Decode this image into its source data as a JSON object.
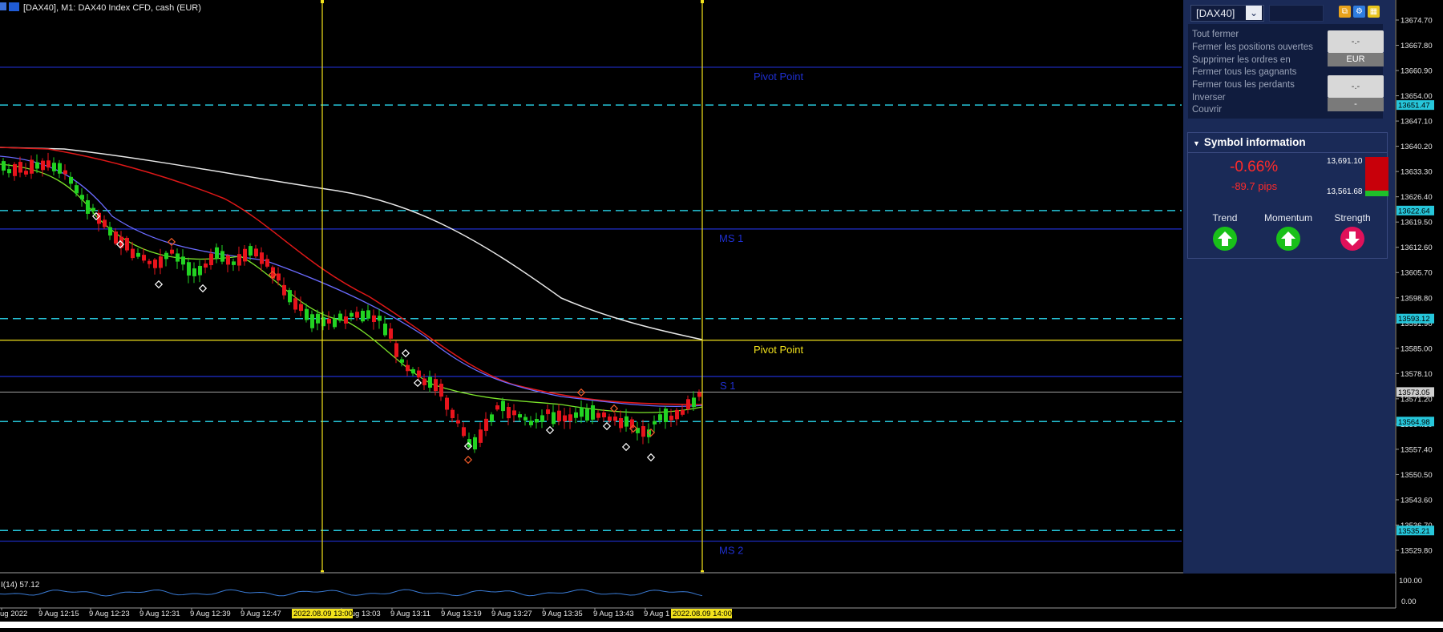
{
  "chart": {
    "title": "[DAX40], M1:  DAX40 Index CFD, cash (EUR)",
    "levels": [
      {
        "label": "Pivot Point",
        "kind": "pivot-blue",
        "price": 13661.8
      },
      {
        "label": "MS 1",
        "kind": "blue-line",
        "price": 13617.6
      },
      {
        "label": "Pivot Point",
        "kind": "pivot-yellow",
        "price": 13587.2
      },
      {
        "label": "S 1",
        "kind": "blue-line",
        "price": 13577.3
      },
      {
        "label": "MS 2",
        "kind": "blue-line",
        "price": 13532.3
      }
    ],
    "cyan_levels": [
      13651.47,
      13622.64,
      13593.12,
      13564.98,
      13535.21
    ],
    "current_price": "13573.05",
    "current_price_value": 13573.05,
    "cyan_level_labels": [
      "13651.47",
      "13622.64",
      "13593.12",
      "13564.98",
      "13535.21"
    ],
    "price_axis": {
      "min": 13529.8,
      "max": 13674.7,
      "ticks": [
        13674.7,
        13667.8,
        13660.9,
        13654.0,
        13647.1,
        13640.2,
        13633.3,
        13626.4,
        13619.5,
        13612.6,
        13605.7,
        13598.8,
        13591.9,
        13585.0,
        13578.1,
        13571.2,
        13564.3,
        13557.4,
        13550.5,
        13543.6,
        13536.7,
        13529.8
      ],
      "tick_labels": [
        "13674.70",
        "13667.80",
        "13660.90",
        "13654.00",
        "13647.10",
        "13640.20",
        "13633.30",
        "13626.40",
        "13619.50",
        "13612.60",
        "13605.70",
        "13598.80",
        "13591.90",
        "13585.00",
        "13578.10",
        "13571.20",
        "13564.30",
        "13557.40",
        "13550.50",
        "13543.60",
        "13536.70",
        "13529.80"
      ]
    },
    "time_labels": [
      "ug 2022",
      "9 Aug 12:15",
      "9 Aug 12:23",
      "9 Aug 12:31",
      "9 Aug 12:39",
      "9 Aug 12:47",
      "9 Aug 13:03",
      "9 Aug 13:11",
      "9 Aug 13:19",
      "9 Aug 13:27",
      "9 Aug 13:35",
      "9 Aug 13:43",
      "9 Aug 1"
    ],
    "time_markers": [
      "2022.08.09 13:00",
      "2022.08.09 14:00"
    ],
    "indicator_label": "I(14) 57.12",
    "indicator_axis": [
      "100.00",
      "0.00"
    ],
    "colors": {
      "up": "#22d322",
      "down": "#e8141c",
      "cyan": "#26c6da",
      "blue": "#1f2fd0",
      "yellow": "#f2e21c",
      "ma_red": "#e01818",
      "ma_white": "#e8e8e8",
      "ma_blue": "#6b6bff",
      "ma_green": "#7be22a",
      "rsi": "#3a7bd5"
    }
  },
  "panel": {
    "symbol": "[DAX40]",
    "menu": [
      "Tout fermer",
      "Fermer les positions ouvertes",
      "Supprimer les ordres en",
      "Fermer tous les gagnants",
      "Fermer tous les perdants",
      "Inverser",
      "Couvrir"
    ],
    "button1": "-.-",
    "currency": "EUR",
    "button2": "-.-",
    "button2_sub": "-",
    "icons": [
      "copy-icon",
      "settings-icon",
      "grid-icon"
    ],
    "symbol_info": {
      "title": "Symbol information",
      "change_pct": "-0.66%",
      "change_pips": "-89.7 pips",
      "high": "13,691.10",
      "low": "13,561.68",
      "range_position": 0.14,
      "indicators": [
        {
          "label": "Trend",
          "direction": "up"
        },
        {
          "label": "Momentum",
          "direction": "up"
        },
        {
          "label": "Strength",
          "direction": "down"
        }
      ]
    }
  }
}
